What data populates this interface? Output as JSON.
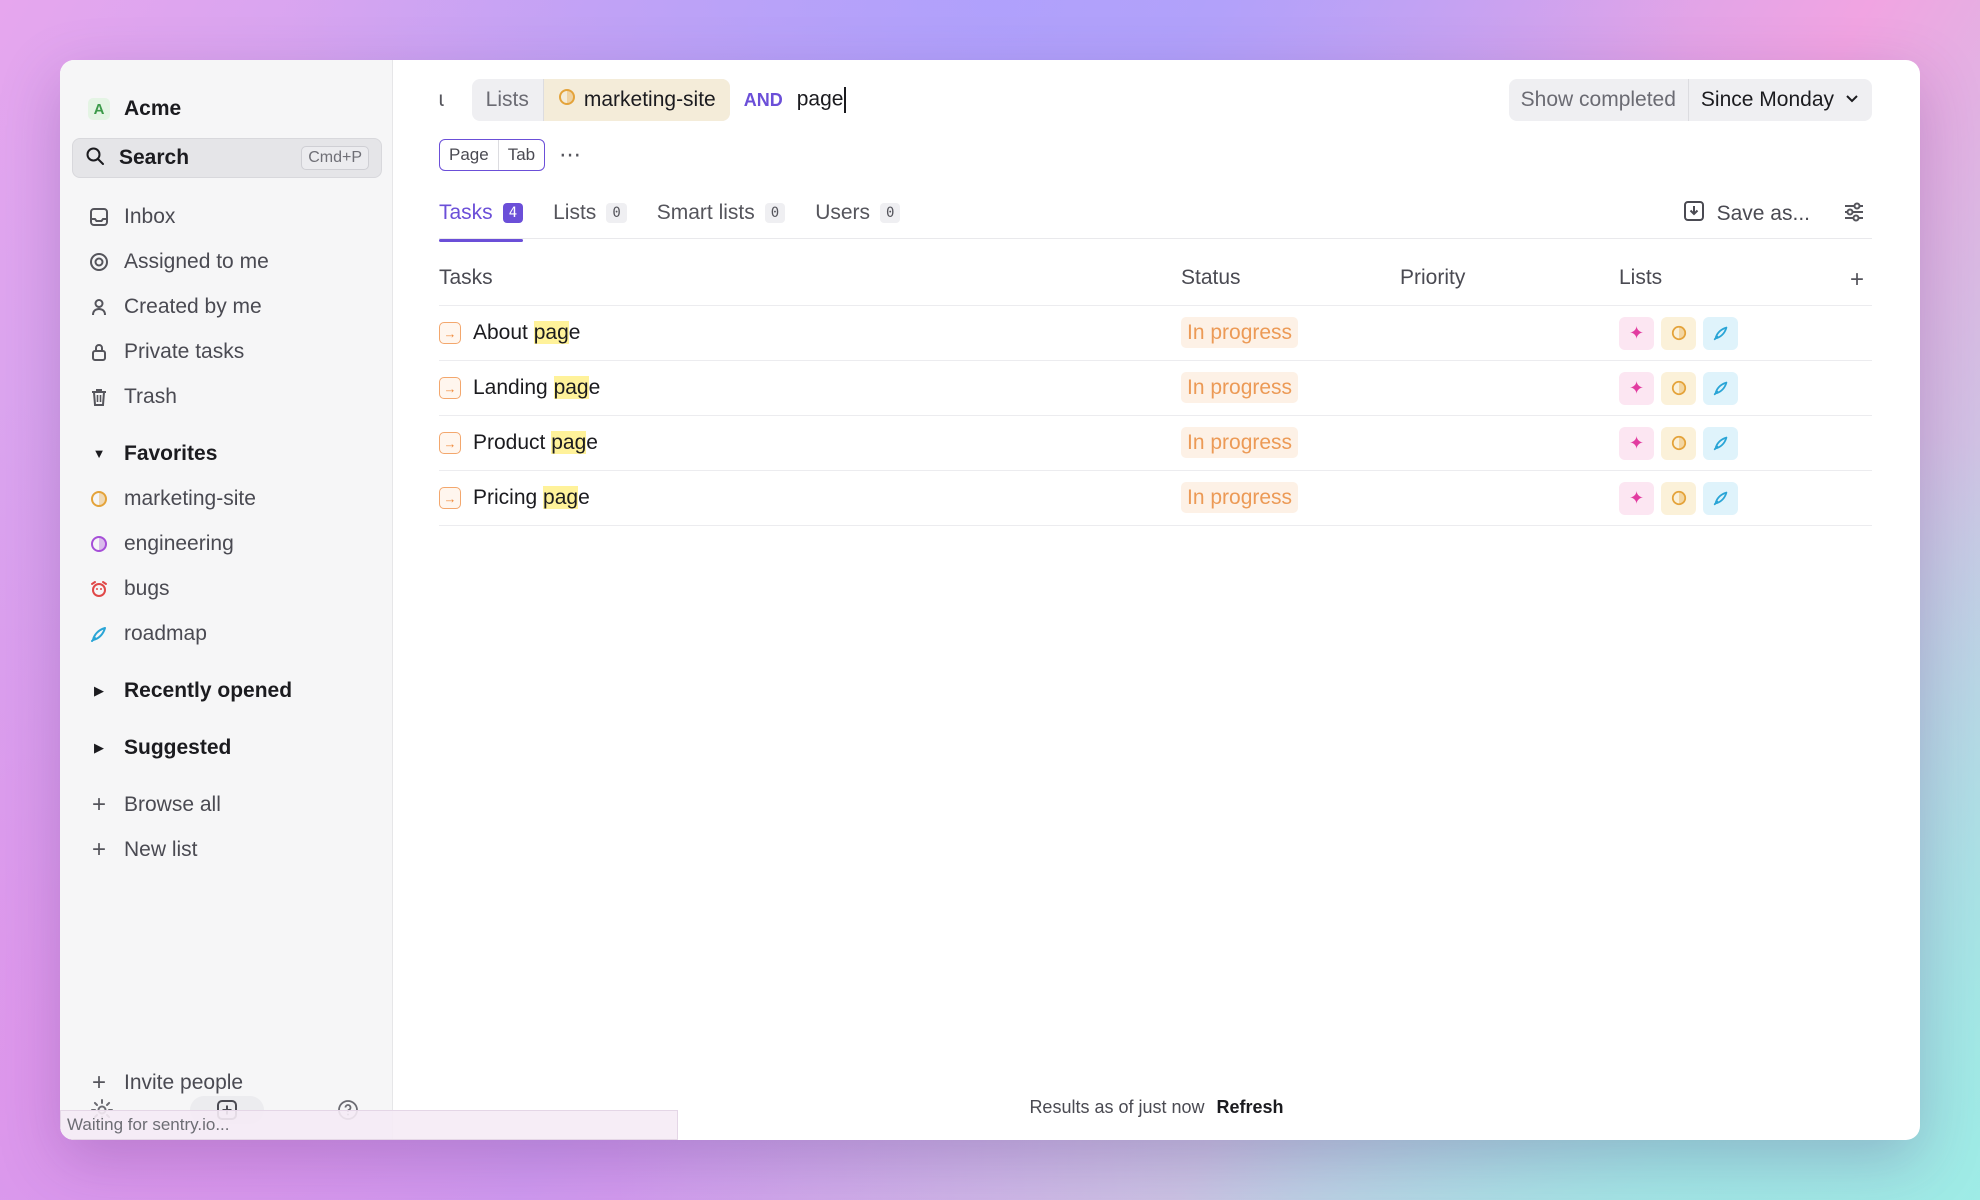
{
  "workspace": {
    "initial": "A",
    "name": "Acme"
  },
  "search": {
    "label": "Search",
    "shortcut": "Cmd+P"
  },
  "sidebar": {
    "nav": [
      {
        "label": "Inbox",
        "icon": "inbox-icon"
      },
      {
        "label": "Assigned to me",
        "icon": "target-icon"
      },
      {
        "label": "Created by me",
        "icon": "user-icon"
      },
      {
        "label": "Private tasks",
        "icon": "lock-icon"
      },
      {
        "label": "Trash",
        "icon": "trash-icon"
      }
    ],
    "favorites_title": "Favorites",
    "favorites": [
      {
        "label": "marketing-site",
        "icon": "half-circle-icon",
        "color": "#e4a33a"
      },
      {
        "label": "engineering",
        "icon": "half-circle-icon",
        "color": "#a64fd8"
      },
      {
        "label": "bugs",
        "icon": "alarm-icon",
        "color": "#e04848"
      },
      {
        "label": "roadmap",
        "icon": "rocket-icon",
        "color": "#2aa5d6"
      }
    ],
    "recently_opened": "Recently opened",
    "suggested": "Suggested",
    "browse_all": "Browse all",
    "new_list": "New list",
    "invite": "Invite people"
  },
  "status_bar": {
    "text": "Waiting for sentry.io..."
  },
  "query": {
    "fragment": "ɩ",
    "filter_key": "Lists",
    "filter_value": "marketing-site",
    "operator": "AND",
    "text": "page"
  },
  "show_completed": "Show completed",
  "since": "Since Monday",
  "hint": {
    "key1": "Page",
    "key2": "Tab"
  },
  "tabs": [
    {
      "label": "Tasks",
      "count": "4"
    },
    {
      "label": "Lists",
      "count": "0"
    },
    {
      "label": "Smart lists",
      "count": "0"
    },
    {
      "label": "Users",
      "count": "0"
    }
  ],
  "save_as": "Save as...",
  "table": {
    "headers": {
      "tasks": "Tasks",
      "status": "Status",
      "priority": "Priority",
      "lists": "Lists"
    },
    "rows": [
      {
        "prefix": "About ",
        "match": "pag",
        "suffix": "e",
        "status": "In progress"
      },
      {
        "prefix": "Landing ",
        "match": "pag",
        "suffix": "e",
        "status": "In progress"
      },
      {
        "prefix": "Product ",
        "match": "pag",
        "suffix": "e",
        "status": "In progress"
      },
      {
        "prefix": "Pricing ",
        "match": "pag",
        "suffix": "e",
        "status": "In progress"
      }
    ]
  },
  "footer": {
    "text": "Results as of just now",
    "refresh": "Refresh"
  }
}
